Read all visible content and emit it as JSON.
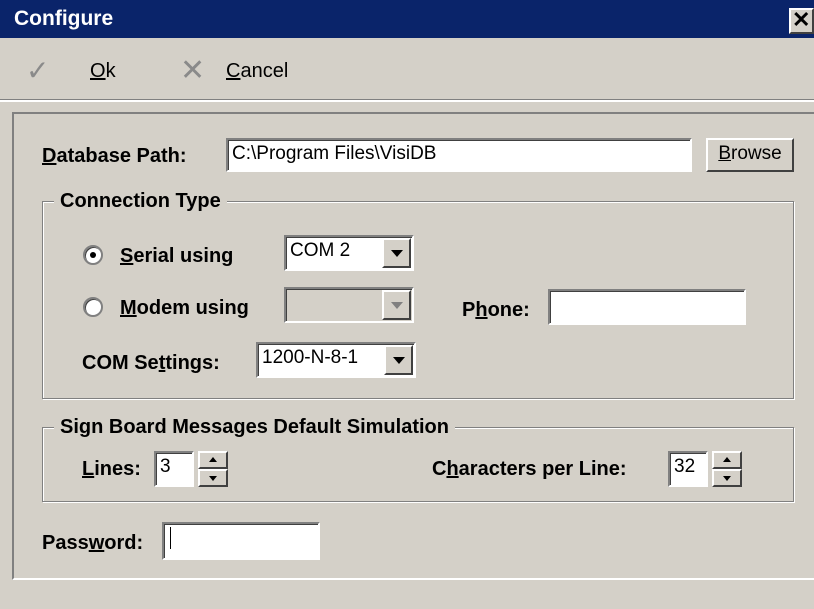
{
  "window": {
    "title": "Configure",
    "close_glyph": "✕"
  },
  "toolbar": {
    "ok_icon": "✓",
    "ok_label": "Ok",
    "ok_mnemonic": "O",
    "ok_rest": "k",
    "cancel_icon": "✕",
    "cancel_label": "Cancel",
    "cancel_mnemonic": "C",
    "cancel_rest": "ancel"
  },
  "database": {
    "label_mnemonic": "D",
    "label_rest": "atabase Path:",
    "path_value": "C:\\Program Files\\VisiDB",
    "browse_mnemonic": "B",
    "browse_rest": "rowse"
  },
  "connection": {
    "group_title": "Connection Type",
    "serial_mnemonic": "S",
    "serial_rest": "erial using",
    "serial_selected": true,
    "serial_port": "COM 2",
    "modem_mnemonic": "M",
    "modem_rest": "odem using",
    "modem_selected": false,
    "modem_port": "",
    "phone_label_pre": "P",
    "phone_label_mnemonic": "h",
    "phone_label_post": "one:",
    "phone_value": "",
    "com_label_pre": "COM Se",
    "com_label_mnemonic": "t",
    "com_label_post": "tings:",
    "com_value": "1200-N-8-1"
  },
  "signboard": {
    "group_title": "Sign Board Messages Default Simulation",
    "lines_mnemonic": "L",
    "lines_rest": "ines:",
    "lines_value": "3",
    "chars_pre": "C",
    "chars_mnemonic": "h",
    "chars_post": "aracters per Line:",
    "chars_value": "32"
  },
  "password": {
    "label_pre": "Pass",
    "label_mnemonic": "w",
    "label_post": "ord:",
    "value": ""
  },
  "icons": {
    "ok": "check-icon",
    "cancel": "x-icon",
    "dropdown": "chevron-down-icon",
    "spin_up": "caret-up-icon",
    "spin_down": "caret-down-icon"
  }
}
